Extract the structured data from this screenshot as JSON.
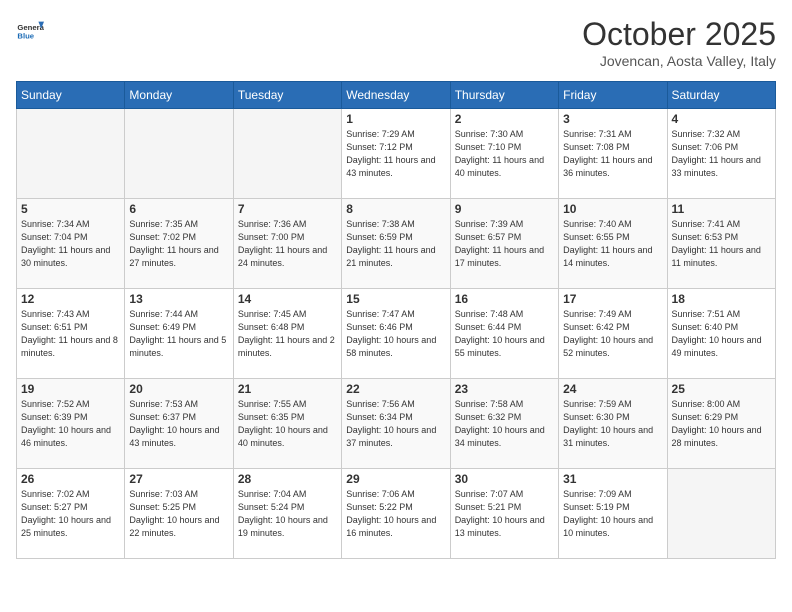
{
  "logo": {
    "general": "General",
    "blue": "Blue"
  },
  "header": {
    "month": "October 2025",
    "location": "Jovencan, Aosta Valley, Italy"
  },
  "weekdays": [
    "Sunday",
    "Monday",
    "Tuesday",
    "Wednesday",
    "Thursday",
    "Friday",
    "Saturday"
  ],
  "weeks": [
    [
      {
        "day": null,
        "info": null
      },
      {
        "day": null,
        "info": null
      },
      {
        "day": null,
        "info": null
      },
      {
        "day": "1",
        "sunrise": "7:29 AM",
        "sunset": "7:12 PM",
        "daylight": "11 hours and 43 minutes."
      },
      {
        "day": "2",
        "sunrise": "7:30 AM",
        "sunset": "7:10 PM",
        "daylight": "11 hours and 40 minutes."
      },
      {
        "day": "3",
        "sunrise": "7:31 AM",
        "sunset": "7:08 PM",
        "daylight": "11 hours and 36 minutes."
      },
      {
        "day": "4",
        "sunrise": "7:32 AM",
        "sunset": "7:06 PM",
        "daylight": "11 hours and 33 minutes."
      }
    ],
    [
      {
        "day": "5",
        "sunrise": "7:34 AM",
        "sunset": "7:04 PM",
        "daylight": "11 hours and 30 minutes."
      },
      {
        "day": "6",
        "sunrise": "7:35 AM",
        "sunset": "7:02 PM",
        "daylight": "11 hours and 27 minutes."
      },
      {
        "day": "7",
        "sunrise": "7:36 AM",
        "sunset": "7:00 PM",
        "daylight": "11 hours and 24 minutes."
      },
      {
        "day": "8",
        "sunrise": "7:38 AM",
        "sunset": "6:59 PM",
        "daylight": "11 hours and 21 minutes."
      },
      {
        "day": "9",
        "sunrise": "7:39 AM",
        "sunset": "6:57 PM",
        "daylight": "11 hours and 17 minutes."
      },
      {
        "day": "10",
        "sunrise": "7:40 AM",
        "sunset": "6:55 PM",
        "daylight": "11 hours and 14 minutes."
      },
      {
        "day": "11",
        "sunrise": "7:41 AM",
        "sunset": "6:53 PM",
        "daylight": "11 hours and 11 minutes."
      }
    ],
    [
      {
        "day": "12",
        "sunrise": "7:43 AM",
        "sunset": "6:51 PM",
        "daylight": "11 hours and 8 minutes."
      },
      {
        "day": "13",
        "sunrise": "7:44 AM",
        "sunset": "6:49 PM",
        "daylight": "11 hours and 5 minutes."
      },
      {
        "day": "14",
        "sunrise": "7:45 AM",
        "sunset": "6:48 PM",
        "daylight": "11 hours and 2 minutes."
      },
      {
        "day": "15",
        "sunrise": "7:47 AM",
        "sunset": "6:46 PM",
        "daylight": "10 hours and 58 minutes."
      },
      {
        "day": "16",
        "sunrise": "7:48 AM",
        "sunset": "6:44 PM",
        "daylight": "10 hours and 55 minutes."
      },
      {
        "day": "17",
        "sunrise": "7:49 AM",
        "sunset": "6:42 PM",
        "daylight": "10 hours and 52 minutes."
      },
      {
        "day": "18",
        "sunrise": "7:51 AM",
        "sunset": "6:40 PM",
        "daylight": "10 hours and 49 minutes."
      }
    ],
    [
      {
        "day": "19",
        "sunrise": "7:52 AM",
        "sunset": "6:39 PM",
        "daylight": "10 hours and 46 minutes."
      },
      {
        "day": "20",
        "sunrise": "7:53 AM",
        "sunset": "6:37 PM",
        "daylight": "10 hours and 43 minutes."
      },
      {
        "day": "21",
        "sunrise": "7:55 AM",
        "sunset": "6:35 PM",
        "daylight": "10 hours and 40 minutes."
      },
      {
        "day": "22",
        "sunrise": "7:56 AM",
        "sunset": "6:34 PM",
        "daylight": "10 hours and 37 minutes."
      },
      {
        "day": "23",
        "sunrise": "7:58 AM",
        "sunset": "6:32 PM",
        "daylight": "10 hours and 34 minutes."
      },
      {
        "day": "24",
        "sunrise": "7:59 AM",
        "sunset": "6:30 PM",
        "daylight": "10 hours and 31 minutes."
      },
      {
        "day": "25",
        "sunrise": "8:00 AM",
        "sunset": "6:29 PM",
        "daylight": "10 hours and 28 minutes."
      }
    ],
    [
      {
        "day": "26",
        "sunrise": "7:02 AM",
        "sunset": "5:27 PM",
        "daylight": "10 hours and 25 minutes."
      },
      {
        "day": "27",
        "sunrise": "7:03 AM",
        "sunset": "5:25 PM",
        "daylight": "10 hours and 22 minutes."
      },
      {
        "day": "28",
        "sunrise": "7:04 AM",
        "sunset": "5:24 PM",
        "daylight": "10 hours and 19 minutes."
      },
      {
        "day": "29",
        "sunrise": "7:06 AM",
        "sunset": "5:22 PM",
        "daylight": "10 hours and 16 minutes."
      },
      {
        "day": "30",
        "sunrise": "7:07 AM",
        "sunset": "5:21 PM",
        "daylight": "10 hours and 13 minutes."
      },
      {
        "day": "31",
        "sunrise": "7:09 AM",
        "sunset": "5:19 PM",
        "daylight": "10 hours and 10 minutes."
      },
      {
        "day": null,
        "info": null
      }
    ]
  ]
}
